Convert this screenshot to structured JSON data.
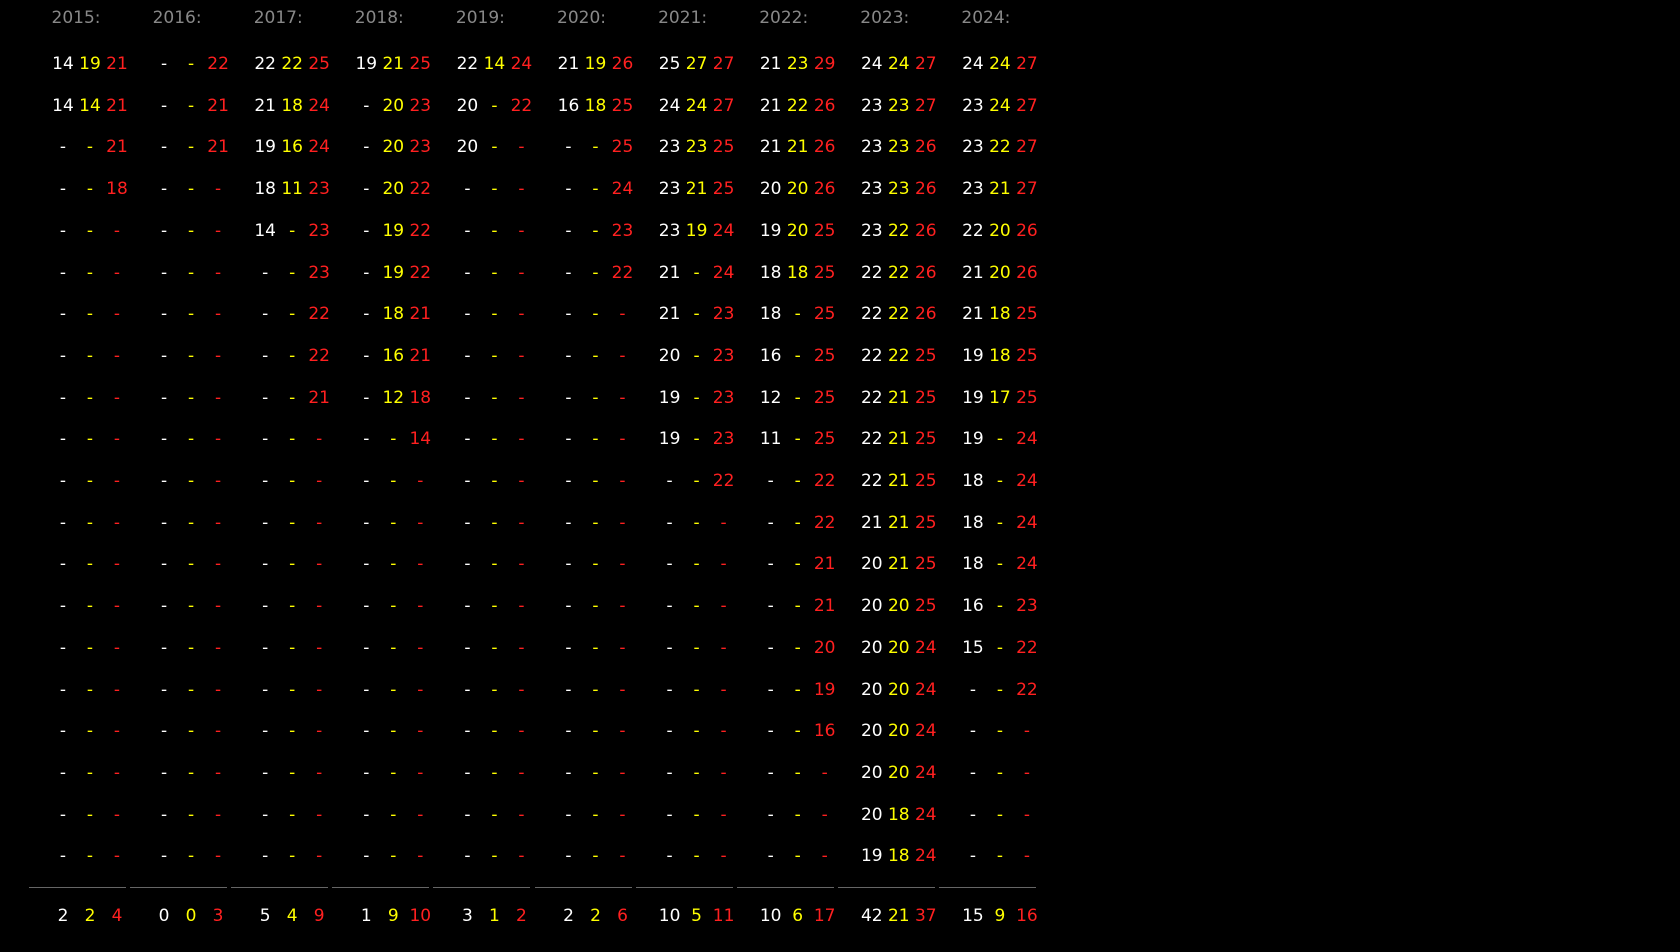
{
  "colors": {
    "first": "#ffffff",
    "second": "#ffff00",
    "third": "#ff2020",
    "header": "#888888",
    "separator": "#666666",
    "background": "#000000"
  },
  "columns": [
    {
      "year": "2015:",
      "rows": [
        [
          "14",
          "19",
          "21"
        ],
        [
          "14",
          "14",
          "21"
        ],
        [
          "-",
          "-",
          "21"
        ],
        [
          "-",
          "-",
          "18"
        ],
        [
          "-",
          "-",
          "-"
        ],
        [
          "-",
          "-",
          "-"
        ],
        [
          "-",
          "-",
          "-"
        ],
        [
          "-",
          "-",
          "-"
        ],
        [
          "-",
          "-",
          "-"
        ],
        [
          "-",
          "-",
          "-"
        ],
        [
          "-",
          "-",
          "-"
        ],
        [
          "-",
          "-",
          "-"
        ],
        [
          "-",
          "-",
          "-"
        ],
        [
          "-",
          "-",
          "-"
        ],
        [
          "-",
          "-",
          "-"
        ],
        [
          "-",
          "-",
          "-"
        ],
        [
          "-",
          "-",
          "-"
        ],
        [
          "-",
          "-",
          "-"
        ],
        [
          "-",
          "-",
          "-"
        ],
        [
          "-",
          "-",
          "-"
        ]
      ],
      "totals": [
        "2",
        "2",
        "4"
      ]
    },
    {
      "year": "2016:",
      "rows": [
        [
          "-",
          "-",
          "22"
        ],
        [
          "-",
          "-",
          "21"
        ],
        [
          "-",
          "-",
          "21"
        ],
        [
          "-",
          "-",
          "-"
        ],
        [
          "-",
          "-",
          "-"
        ],
        [
          "-",
          "-",
          "-"
        ],
        [
          "-",
          "-",
          "-"
        ],
        [
          "-",
          "-",
          "-"
        ],
        [
          "-",
          "-",
          "-"
        ],
        [
          "-",
          "-",
          "-"
        ],
        [
          "-",
          "-",
          "-"
        ],
        [
          "-",
          "-",
          "-"
        ],
        [
          "-",
          "-",
          "-"
        ],
        [
          "-",
          "-",
          "-"
        ],
        [
          "-",
          "-",
          "-"
        ],
        [
          "-",
          "-",
          "-"
        ],
        [
          "-",
          "-",
          "-"
        ],
        [
          "-",
          "-",
          "-"
        ],
        [
          "-",
          "-",
          "-"
        ],
        [
          "-",
          "-",
          "-"
        ]
      ],
      "totals": [
        "0",
        "0",
        "3"
      ]
    },
    {
      "year": "2017:",
      "rows": [
        [
          "22",
          "22",
          "25"
        ],
        [
          "21",
          "18",
          "24"
        ],
        [
          "19",
          "16",
          "24"
        ],
        [
          "18",
          "11",
          "23"
        ],
        [
          "14",
          "-",
          "23"
        ],
        [
          "-",
          "-",
          "23"
        ],
        [
          "-",
          "-",
          "22"
        ],
        [
          "-",
          "-",
          "22"
        ],
        [
          "-",
          "-",
          "21"
        ],
        [
          "-",
          "-",
          "-"
        ],
        [
          "-",
          "-",
          "-"
        ],
        [
          "-",
          "-",
          "-"
        ],
        [
          "-",
          "-",
          "-"
        ],
        [
          "-",
          "-",
          "-"
        ],
        [
          "-",
          "-",
          "-"
        ],
        [
          "-",
          "-",
          "-"
        ],
        [
          "-",
          "-",
          "-"
        ],
        [
          "-",
          "-",
          "-"
        ],
        [
          "-",
          "-",
          "-"
        ],
        [
          "-",
          "-",
          "-"
        ]
      ],
      "totals": [
        "5",
        "4",
        "9"
      ]
    },
    {
      "year": "2018:",
      "rows": [
        [
          "19",
          "21",
          "25"
        ],
        [
          "-",
          "20",
          "23"
        ],
        [
          "-",
          "20",
          "23"
        ],
        [
          "-",
          "20",
          "22"
        ],
        [
          "-",
          "19",
          "22"
        ],
        [
          "-",
          "19",
          "22"
        ],
        [
          "-",
          "18",
          "21"
        ],
        [
          "-",
          "16",
          "21"
        ],
        [
          "-",
          "12",
          "18"
        ],
        [
          "-",
          "-",
          "14"
        ],
        [
          "-",
          "-",
          "-"
        ],
        [
          "-",
          "-",
          "-"
        ],
        [
          "-",
          "-",
          "-"
        ],
        [
          "-",
          "-",
          "-"
        ],
        [
          "-",
          "-",
          "-"
        ],
        [
          "-",
          "-",
          "-"
        ],
        [
          "-",
          "-",
          "-"
        ],
        [
          "-",
          "-",
          "-"
        ],
        [
          "-",
          "-",
          "-"
        ],
        [
          "-",
          "-",
          "-"
        ]
      ],
      "totals": [
        "1",
        "9",
        "10"
      ]
    },
    {
      "year": "2019:",
      "rows": [
        [
          "22",
          "14",
          "24"
        ],
        [
          "20",
          "-",
          "22"
        ],
        [
          "20",
          "-",
          "-"
        ],
        [
          "-",
          "-",
          "-"
        ],
        [
          "-",
          "-",
          "-"
        ],
        [
          "-",
          "-",
          "-"
        ],
        [
          "-",
          "-",
          "-"
        ],
        [
          "-",
          "-",
          "-"
        ],
        [
          "-",
          "-",
          "-"
        ],
        [
          "-",
          "-",
          "-"
        ],
        [
          "-",
          "-",
          "-"
        ],
        [
          "-",
          "-",
          "-"
        ],
        [
          "-",
          "-",
          "-"
        ],
        [
          "-",
          "-",
          "-"
        ],
        [
          "-",
          "-",
          "-"
        ],
        [
          "-",
          "-",
          "-"
        ],
        [
          "-",
          "-",
          "-"
        ],
        [
          "-",
          "-",
          "-"
        ],
        [
          "-",
          "-",
          "-"
        ],
        [
          "-",
          "-",
          "-"
        ]
      ],
      "totals": [
        "3",
        "1",
        "2"
      ]
    },
    {
      "year": "2020:",
      "rows": [
        [
          "21",
          "19",
          "26"
        ],
        [
          "16",
          "18",
          "25"
        ],
        [
          "-",
          "-",
          "25"
        ],
        [
          "-",
          "-",
          "24"
        ],
        [
          "-",
          "-",
          "23"
        ],
        [
          "-",
          "-",
          "22"
        ],
        [
          "-",
          "-",
          "-"
        ],
        [
          "-",
          "-",
          "-"
        ],
        [
          "-",
          "-",
          "-"
        ],
        [
          "-",
          "-",
          "-"
        ],
        [
          "-",
          "-",
          "-"
        ],
        [
          "-",
          "-",
          "-"
        ],
        [
          "-",
          "-",
          "-"
        ],
        [
          "-",
          "-",
          "-"
        ],
        [
          "-",
          "-",
          "-"
        ],
        [
          "-",
          "-",
          "-"
        ],
        [
          "-",
          "-",
          "-"
        ],
        [
          "-",
          "-",
          "-"
        ],
        [
          "-",
          "-",
          "-"
        ],
        [
          "-",
          "-",
          "-"
        ]
      ],
      "totals": [
        "2",
        "2",
        "6"
      ]
    },
    {
      "year": "2021:",
      "rows": [
        [
          "25",
          "27",
          "27"
        ],
        [
          "24",
          "24",
          "27"
        ],
        [
          "23",
          "23",
          "25"
        ],
        [
          "23",
          "21",
          "25"
        ],
        [
          "23",
          "19",
          "24"
        ],
        [
          "21",
          "-",
          "24"
        ],
        [
          "21",
          "-",
          "23"
        ],
        [
          "20",
          "-",
          "23"
        ],
        [
          "19",
          "-",
          "23"
        ],
        [
          "19",
          "-",
          "23"
        ],
        [
          "-",
          "-",
          "22"
        ],
        [
          "-",
          "-",
          "-"
        ],
        [
          "-",
          "-",
          "-"
        ],
        [
          "-",
          "-",
          "-"
        ],
        [
          "-",
          "-",
          "-"
        ],
        [
          "-",
          "-",
          "-"
        ],
        [
          "-",
          "-",
          "-"
        ],
        [
          "-",
          "-",
          "-"
        ],
        [
          "-",
          "-",
          "-"
        ],
        [
          "-",
          "-",
          "-"
        ]
      ],
      "totals": [
        "10",
        "5",
        "11"
      ]
    },
    {
      "year": "2022:",
      "rows": [
        [
          "21",
          "23",
          "29"
        ],
        [
          "21",
          "22",
          "26"
        ],
        [
          "21",
          "21",
          "26"
        ],
        [
          "20",
          "20",
          "26"
        ],
        [
          "19",
          "20",
          "25"
        ],
        [
          "18",
          "18",
          "25"
        ],
        [
          "18",
          "-",
          "25"
        ],
        [
          "16",
          "-",
          "25"
        ],
        [
          "12",
          "-",
          "25"
        ],
        [
          "11",
          "-",
          "25"
        ],
        [
          "-",
          "-",
          "22"
        ],
        [
          "-",
          "-",
          "22"
        ],
        [
          "-",
          "-",
          "21"
        ],
        [
          "-",
          "-",
          "21"
        ],
        [
          "-",
          "-",
          "20"
        ],
        [
          "-",
          "-",
          "19"
        ],
        [
          "-",
          "-",
          "16"
        ],
        [
          "-",
          "-",
          "-"
        ],
        [
          "-",
          "-",
          "-"
        ],
        [
          "-",
          "-",
          "-"
        ]
      ],
      "totals": [
        "10",
        "6",
        "17"
      ]
    },
    {
      "year": "2023:",
      "rows": [
        [
          "24",
          "24",
          "27"
        ],
        [
          "23",
          "23",
          "27"
        ],
        [
          "23",
          "23",
          "26"
        ],
        [
          "23",
          "23",
          "26"
        ],
        [
          "23",
          "22",
          "26"
        ],
        [
          "22",
          "22",
          "26"
        ],
        [
          "22",
          "22",
          "26"
        ],
        [
          "22",
          "22",
          "25"
        ],
        [
          "22",
          "21",
          "25"
        ],
        [
          "22",
          "21",
          "25"
        ],
        [
          "22",
          "21",
          "25"
        ],
        [
          "21",
          "21",
          "25"
        ],
        [
          "20",
          "21",
          "25"
        ],
        [
          "20",
          "20",
          "25"
        ],
        [
          "20",
          "20",
          "24"
        ],
        [
          "20",
          "20",
          "24"
        ],
        [
          "20",
          "20",
          "24"
        ],
        [
          "20",
          "20",
          "24"
        ],
        [
          "20",
          "18",
          "24"
        ],
        [
          "19",
          "18",
          "24"
        ]
      ],
      "totals": [
        "42",
        "21",
        "37"
      ]
    },
    {
      "year": "2024:",
      "rows": [
        [
          "24",
          "24",
          "27"
        ],
        [
          "23",
          "24",
          "27"
        ],
        [
          "23",
          "22",
          "27"
        ],
        [
          "23",
          "21",
          "27"
        ],
        [
          "22",
          "20",
          "26"
        ],
        [
          "21",
          "20",
          "26"
        ],
        [
          "21",
          "18",
          "25"
        ],
        [
          "19",
          "18",
          "25"
        ],
        [
          "19",
          "17",
          "25"
        ],
        [
          "19",
          "-",
          "24"
        ],
        [
          "18",
          "-",
          "24"
        ],
        [
          "18",
          "-",
          "24"
        ],
        [
          "18",
          "-",
          "24"
        ],
        [
          "16",
          "-",
          "23"
        ],
        [
          "15",
          "-",
          "22"
        ],
        [
          "-",
          "-",
          "22"
        ],
        [
          "-",
          "-",
          "-"
        ],
        [
          "-",
          "-",
          "-"
        ],
        [
          "-",
          "-",
          "-"
        ],
        [
          "-",
          "-",
          "-"
        ]
      ],
      "totals": [
        "15",
        "9",
        "16"
      ]
    }
  ]
}
